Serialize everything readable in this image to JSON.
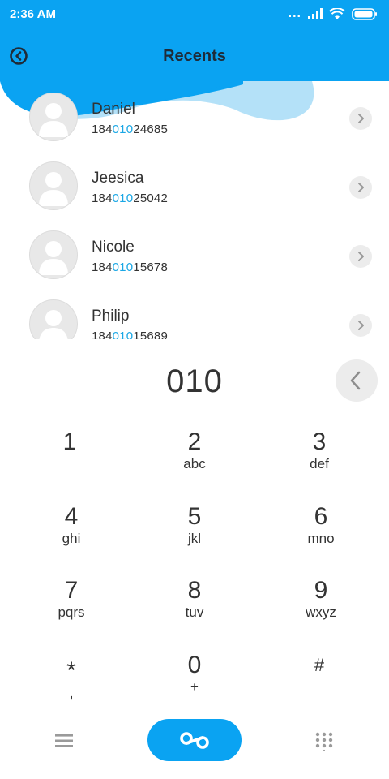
{
  "status_bar": {
    "time": "2:36 AM",
    "dots": "..."
  },
  "header": {
    "title": "Recents"
  },
  "recents": [
    {
      "name": "Daniel",
      "number_prefix": "184",
      "number_match": "010",
      "number_suffix": "24685"
    },
    {
      "name": "Jeesica",
      "number_prefix": "184",
      "number_match": "010",
      "number_suffix": "25042"
    },
    {
      "name": "Nicole",
      "number_prefix": "184",
      "number_match": "010",
      "number_suffix": "15678"
    },
    {
      "name": "Philip",
      "number_prefix": "184",
      "number_match": "010",
      "number_suffix": "15689"
    }
  ],
  "dialer": {
    "input": "010"
  },
  "keypad": [
    {
      "digit": "1",
      "letters": ""
    },
    {
      "digit": "2",
      "letters": "abc"
    },
    {
      "digit": "3",
      "letters": "def"
    },
    {
      "digit": "4",
      "letters": "ghi"
    },
    {
      "digit": "5",
      "letters": "jkl"
    },
    {
      "digit": "6",
      "letters": "mno"
    },
    {
      "digit": "7",
      "letters": "pqrs"
    },
    {
      "digit": "8",
      "letters": "tuv"
    },
    {
      "digit": "9",
      "letters": "wxyz"
    },
    {
      "digit": "*",
      "letters": ","
    },
    {
      "digit": "0",
      "letters": "+"
    },
    {
      "digit": "#",
      "letters": ""
    }
  ],
  "colors": {
    "accent": "#0aa3f2",
    "accent_light": "#b4e1f8",
    "highlight": "#1aa7e5"
  }
}
